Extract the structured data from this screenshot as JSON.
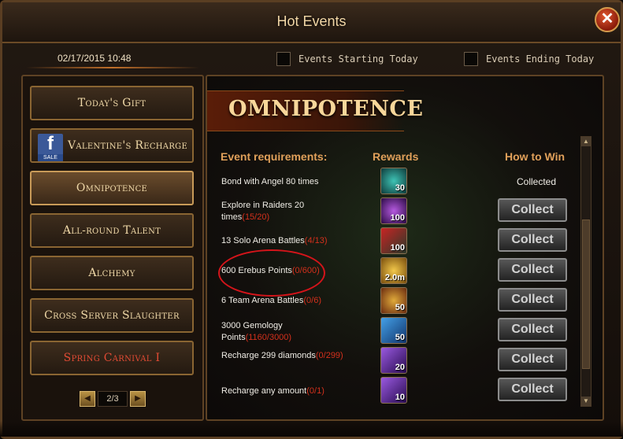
{
  "window": {
    "title": "Hot Events",
    "close_label": "✕"
  },
  "datetime": "02/17/2015 10:48",
  "filters": {
    "starting_today": "Events Starting Today",
    "ending_today": "Events Ending Today"
  },
  "sidebar": {
    "items": [
      {
        "label": "Today's Gift"
      },
      {
        "label": "Valentine's Recharge",
        "icon": "facebook-sale-icon"
      },
      {
        "label": "Omnipotence",
        "active": true
      },
      {
        "label": "All-round Talent"
      },
      {
        "label": "Alchemy"
      },
      {
        "label": "Cross Server Slaughter"
      },
      {
        "label": "Spring Carnival I",
        "color": "#e24b34"
      }
    ],
    "pager": {
      "prev": "◀",
      "next": "▶",
      "page": "2/3"
    }
  },
  "event": {
    "title": "OMNIPOTENCE",
    "headers": {
      "requirements": "Event requirements:",
      "rewards": "Rewards",
      "how_to_win": "How to Win"
    },
    "rows": [
      {
        "req": "Bond with Angel 80 times",
        "progress": "",
        "reward_qty": "30",
        "reward_icon": "angel-orb-icon",
        "status": "Collected"
      },
      {
        "req": "Explore in Raiders 20 times",
        "progress": "(15/20)",
        "reward_qty": "100",
        "reward_icon": "purple-orb-icon",
        "status": "Collect"
      },
      {
        "req": "13 Solo Arena Battles",
        "progress": "(4/13)",
        "reward_qty": "100",
        "reward_icon": "arena-badge-icon",
        "status": "Collect"
      },
      {
        "req": "600 Erebus Points",
        "progress": "(0/600)",
        "reward_qty": "2.0m",
        "reward_icon": "gold-coin-icon",
        "status": "Collect"
      },
      {
        "req": "6 Team Arena Battles",
        "progress": "(0/6)",
        "reward_qty": "50",
        "reward_icon": "shield-badge-icon",
        "status": "Collect"
      },
      {
        "req": "3000 Gemology Points",
        "progress": "(1160/3000)",
        "reward_qty": "50",
        "reward_icon": "gem-50-icon",
        "status": "Collect"
      },
      {
        "req": "Recharge 299 diamonds",
        "progress": "(0/299)",
        "reward_qty": "20",
        "reward_icon": "purple-crystal-icon",
        "status": "Collect"
      },
      {
        "req": "Recharge any amount",
        "progress": "(0/1)",
        "reward_qty": "10",
        "reward_icon": "purple-crystal-icon",
        "status": "Collect"
      }
    ]
  },
  "colors": {
    "accent": "#e0a05a",
    "progress": "#d4301c",
    "highlight_circle": "#d4141a"
  }
}
